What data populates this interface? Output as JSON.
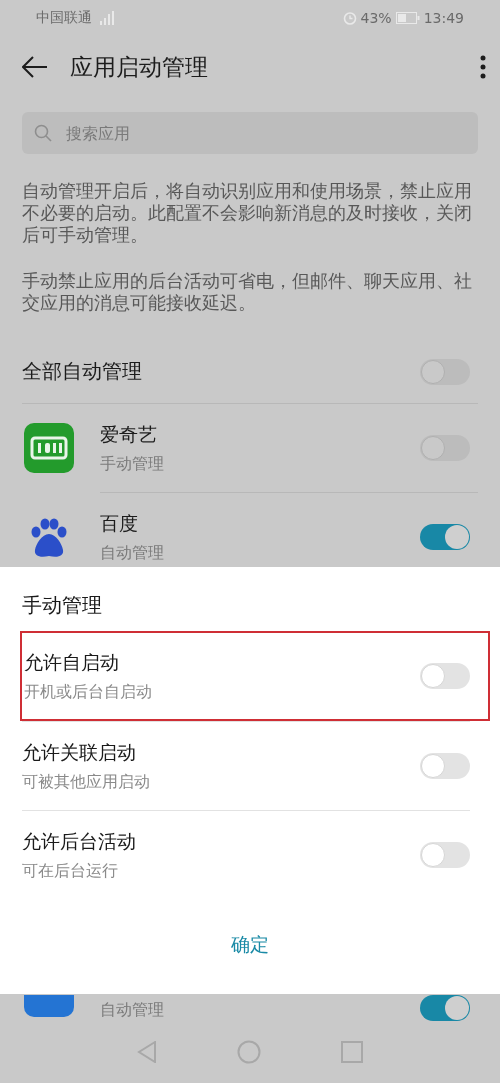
{
  "status_bar": {
    "carrier": "中国联通",
    "battery": "43%",
    "time": "13:49"
  },
  "toolbar": {
    "title": "应用启动管理"
  },
  "search": {
    "placeholder": "搜索应用"
  },
  "notes": [
    "自动管理开启后，将自动识别应用和使用场景，禁止应用不必要的启动。此配置不会影响新消息的及时接收，关闭后可手动管理。",
    "手动禁止应用的后台活动可省电，但邮件、聊天应用、社交应用的消息可能接收延迟。"
  ],
  "all_auto": {
    "label": "全部自动管理",
    "on": false
  },
  "apps": [
    {
      "kind": "tile",
      "name": "爱奇艺",
      "mode": "手动管理",
      "on": false
    },
    {
      "kind": "paw",
      "name": "百度",
      "mode": "自动管理",
      "on": true
    }
  ],
  "partial_app": {
    "mode": "自动管理",
    "on": true
  },
  "sheet": {
    "title": "手动管理",
    "options": [
      {
        "label": "允许自启动",
        "hint": "开机或后台自启动",
        "on": false,
        "highlighted": true
      },
      {
        "label": "允许关联启动",
        "hint": "可被其他应用启动",
        "on": false,
        "highlighted": false
      },
      {
        "label": "允许后台活动",
        "hint": "可在后台运行",
        "on": false,
        "highlighted": false
      }
    ],
    "confirm": "确定"
  }
}
